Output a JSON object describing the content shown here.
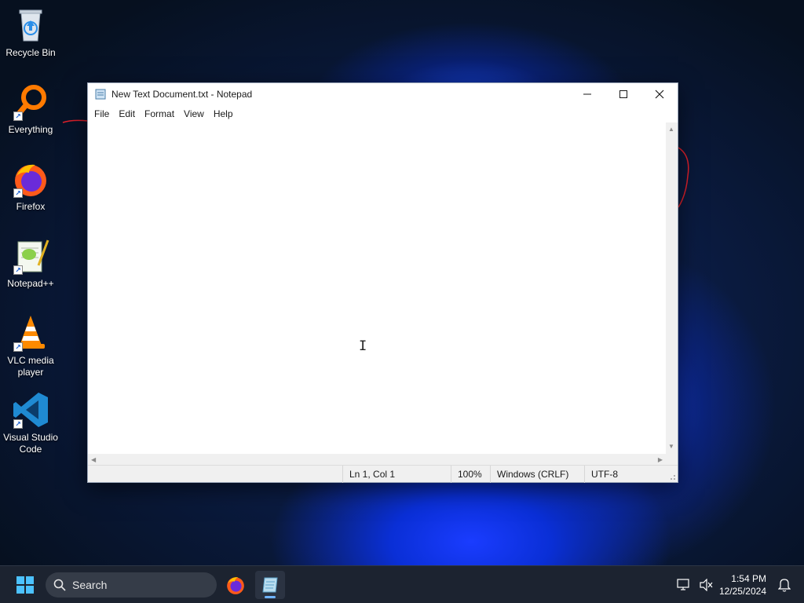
{
  "desktop": {
    "icons": [
      {
        "label": "Recycle Bin",
        "icon": "recycle-bin-icon"
      },
      {
        "label": "Everything",
        "icon": "everything-search-icon"
      },
      {
        "label": "Firefox",
        "icon": "firefox-icon"
      },
      {
        "label": "Notepad++",
        "icon": "notepadpp-icon"
      },
      {
        "label": "VLC media player",
        "icon": "vlc-icon"
      },
      {
        "label": "Visual Studio Code",
        "icon": "vscode-icon"
      }
    ]
  },
  "notepad": {
    "title": "New Text Document.txt - Notepad",
    "menu": [
      "File",
      "Edit",
      "Format",
      "View",
      "Help"
    ],
    "content": "",
    "status": {
      "position": "Ln 1, Col 1",
      "zoom": "100%",
      "line_ending": "Windows (CRLF)",
      "encoding": "UTF-8"
    }
  },
  "taskbar": {
    "search_placeholder": "Search",
    "apps": [
      "firefox-icon",
      "notepad-icon"
    ],
    "clock": {
      "time": "1:54 PM",
      "date": "12/25/2024"
    }
  },
  "colors": {
    "accent": "#0078d4",
    "annotation_red": "#e0202a",
    "taskbar_bg": "#1c2330"
  }
}
